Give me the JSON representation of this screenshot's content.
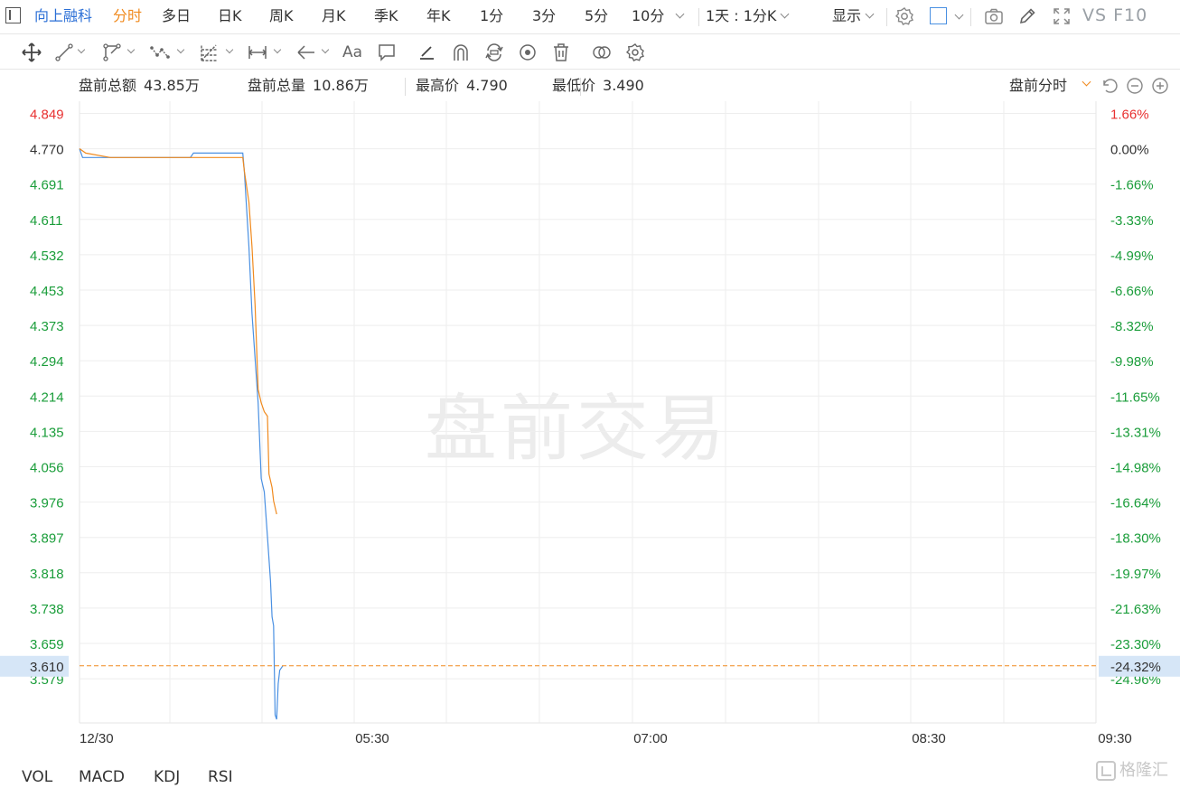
{
  "top_tabs": {
    "stock_name": "向上融科",
    "items": [
      "分时",
      "多日",
      "日K",
      "周K",
      "月K",
      "季K",
      "年K",
      "1分",
      "3分",
      "5分",
      "10分"
    ],
    "active": "分时",
    "range_select": "1天 : 1分K",
    "display_menu": "显示",
    "vs_f10": "VS F10"
  },
  "drawing_tools": [
    "move-tool",
    "line-tool",
    "channel-tool",
    "wave-tool",
    "fib-tool",
    "measure-tool",
    "arrow-tool",
    "text-tool",
    "comment-tool",
    "pen-tool",
    "magnet-tool",
    "sync-tool",
    "visibility-tool",
    "delete-tool",
    "compare-tool",
    "settings-tool"
  ],
  "text_tool_label": "Aa",
  "stats": {
    "amount_label": "盘前总额",
    "amount_value": "43.85万",
    "volume_label": "盘前总量",
    "volume_value": "10.86万",
    "high_label": "最高价",
    "high_value": "4.790",
    "low_label": "最低价",
    "low_value": "3.490"
  },
  "mode_select": "盘前分时",
  "watermark": "盘前交易",
  "chart_data": {
    "type": "line",
    "y_left_ticks": [
      "4.849",
      "4.770",
      "4.691",
      "4.611",
      "4.532",
      "4.453",
      "4.373",
      "4.294",
      "4.214",
      "4.135",
      "4.056",
      "3.976",
      "3.897",
      "3.818",
      "3.738",
      "3.659",
      "3.579"
    ],
    "y_right_ticks": [
      "1.66%",
      "0.00%",
      "-1.66%",
      "-3.33%",
      "-4.99%",
      "-6.66%",
      "-8.32%",
      "-9.98%",
      "-11.65%",
      "-13.31%",
      "-14.98%",
      "-16.64%",
      "-18.30%",
      "-19.97%",
      "-21.63%",
      "-23.30%",
      "-24.96%"
    ],
    "x_ticks": [
      "12/30",
      "05:30",
      "07:00",
      "08:30",
      "09:30"
    ],
    "ylim": [
      3.49,
      4.88
    ],
    "xlim": [
      0,
      330
    ],
    "current_price": "3.610",
    "current_change": "-24.32%",
    "current_value": 3.61,
    "colors": {
      "price": "#4a90e2",
      "average": "#f08a1e",
      "up": "#e83030",
      "down": "#1a9d3a",
      "crosshair": "#f08a1e",
      "label_bg": "#d6e6f7"
    },
    "series": [
      {
        "color": "#4a90e2",
        "points": [
          [
            0,
            4.77
          ],
          [
            1,
            4.75
          ],
          [
            10,
            4.75
          ],
          [
            20,
            4.75
          ],
          [
            30,
            4.75
          ],
          [
            36,
            4.75
          ],
          [
            37,
            4.76
          ],
          [
            44,
            4.76
          ],
          [
            50,
            4.76
          ],
          [
            53,
            4.76
          ],
          [
            53.5,
            4.72
          ],
          [
            55,
            4.55
          ],
          [
            56,
            4.4
          ],
          [
            58,
            4.2
          ],
          [
            59,
            4.03
          ],
          [
            60,
            4.0
          ],
          [
            61,
            3.9
          ],
          [
            62,
            3.8
          ],
          [
            62.5,
            3.72
          ],
          [
            63,
            3.7
          ],
          [
            63.5,
            3.5
          ],
          [
            64,
            3.49
          ],
          [
            64.5,
            3.57
          ],
          [
            65,
            3.6
          ],
          [
            66,
            3.61
          ]
        ]
      },
      {
        "color": "#f08a1e",
        "points": [
          [
            0,
            4.77
          ],
          [
            2,
            4.76
          ],
          [
            10,
            4.75
          ],
          [
            20,
            4.75
          ],
          [
            30,
            4.75
          ],
          [
            36,
            4.75
          ],
          [
            44,
            4.75
          ],
          [
            50,
            4.75
          ],
          [
            53,
            4.75
          ],
          [
            53.5,
            4.72
          ],
          [
            55,
            4.65
          ],
          [
            56,
            4.55
          ],
          [
            57,
            4.42
          ],
          [
            58,
            4.23
          ],
          [
            59,
            4.2
          ],
          [
            60,
            4.18
          ],
          [
            61,
            4.17
          ],
          [
            61.5,
            4.04
          ],
          [
            62.5,
            4.01
          ],
          [
            63,
            3.98
          ],
          [
            64,
            3.95
          ]
        ]
      }
    ]
  },
  "bottom_indicators": [
    "VOL",
    "MACD",
    "KDJ",
    "RSI"
  ],
  "brand_logo": "格隆汇"
}
